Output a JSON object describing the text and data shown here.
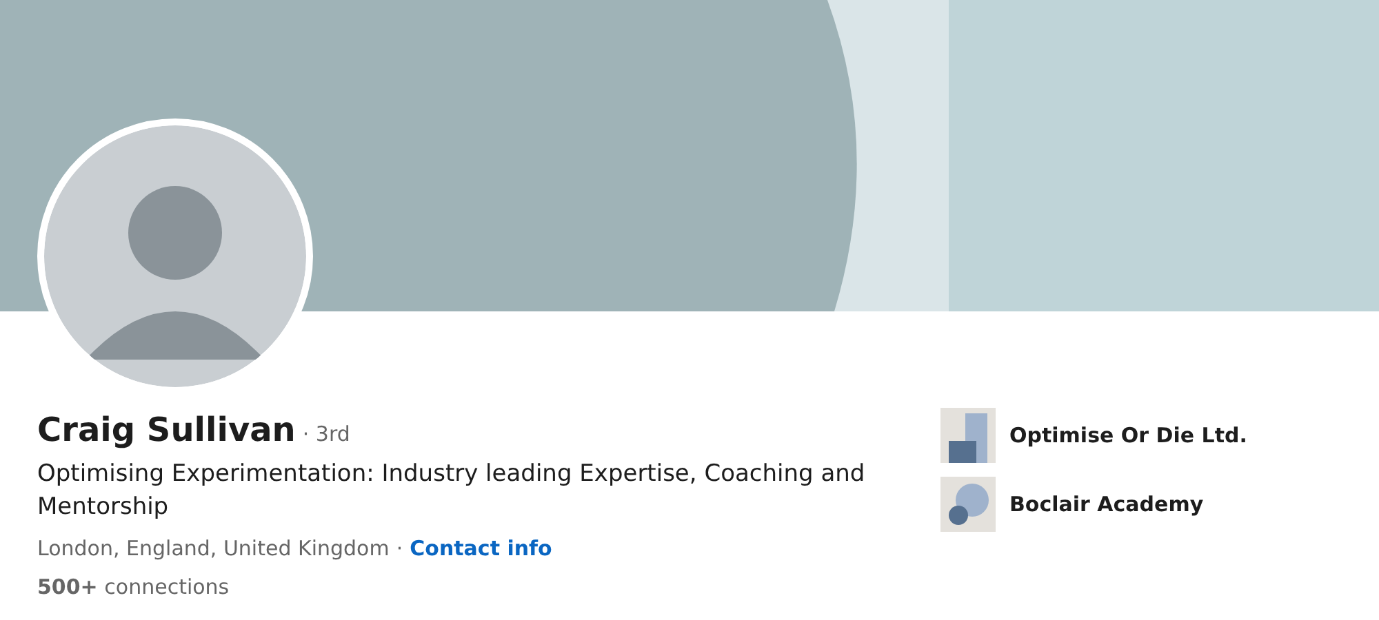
{
  "profile": {
    "name": "Craig Sullivan",
    "degree": "· 3rd",
    "headline": "Optimising Experimentation: Industry leading Expertise, Coaching and Mentorship",
    "location": "London, England, United Kingdom",
    "location_separator": "·",
    "contact_link": "Contact info",
    "connections": "**500+** connections"
  },
  "companies": [
    {
      "name": "Optimise Or Die Ltd."
    },
    {
      "name": "Boclair Academy"
    }
  ]
}
